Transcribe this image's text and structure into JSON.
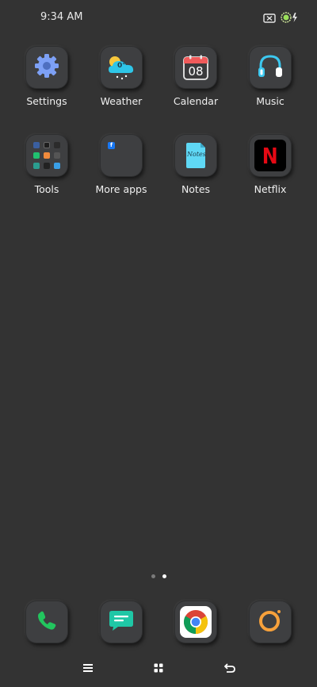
{
  "status_bar": {
    "time": "9:34 AM"
  },
  "apps": [
    {
      "id": "settings",
      "label": "Settings",
      "icon": "gear-icon"
    },
    {
      "id": "weather",
      "label": "Weather",
      "icon": "weather-cloud-icon",
      "temp": "0°"
    },
    {
      "id": "calendar",
      "label": "Calendar",
      "icon": "calendar-icon",
      "date": "08"
    },
    {
      "id": "music",
      "label": "Music",
      "icon": "headphones-icon"
    },
    {
      "id": "tools",
      "label": "Tools",
      "icon": "folder-icon"
    },
    {
      "id": "more-apps",
      "label": "More apps",
      "icon": "folder-icon"
    },
    {
      "id": "notes",
      "label": "Notes",
      "icon": "notes-icon",
      "note_text": "Notes"
    },
    {
      "id": "netflix",
      "label": "Netflix",
      "icon": "netflix-icon",
      "letter": "N"
    }
  ],
  "dock": [
    {
      "id": "phone",
      "icon": "phone-icon"
    },
    {
      "id": "messages",
      "icon": "message-icon"
    },
    {
      "id": "chrome",
      "icon": "chrome-icon"
    },
    {
      "id": "camera",
      "icon": "camera-icon"
    }
  ],
  "page_indicator": {
    "count": 2,
    "active": 2
  },
  "colors": {
    "background": "#333333",
    "tile": "#3e3f41",
    "settings_blue": "#7da0f5",
    "weather_cyan": "#2ec6e8",
    "weather_sun": "#f7c73c",
    "calendar_red": "#f05a5a",
    "music_cyan": "#3cc8f0",
    "notes_cyan": "#5fd8f5",
    "netflix_red": "#e50914",
    "phone_green": "#22c55e",
    "messages_teal": "#1fc7a6",
    "camera_orange": "#f7a13b"
  }
}
